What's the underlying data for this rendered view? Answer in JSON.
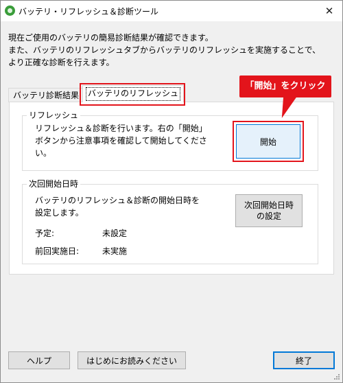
{
  "window": {
    "title": "バッテリ・リフレッシュ＆診断ツール",
    "close_glyph": "✕"
  },
  "intro": {
    "lines": [
      "現在ご使用のバッテリの簡易診断結果が確認できます。",
      "また、バッテリのリフレッシュタブからバッテリのリフレッシュを実施することで、",
      "より正確な診断を行えます。"
    ]
  },
  "tabs": [
    {
      "label": "バッテリ診断結果",
      "selected": false
    },
    {
      "label": "バッテリのリフレッシュ",
      "selected": true
    }
  ],
  "callout": {
    "text": "「開始」をクリック",
    "color": "#e3141b"
  },
  "refresh_group": {
    "title": "リフレッシュ",
    "lines": [
      "リフレッシュ＆診断を行います。右の「開始」",
      "ボタンから注意事項を確認して開始してくださ",
      "い。"
    ],
    "start_button": "開始"
  },
  "schedule_group": {
    "title": "次回開始日時",
    "lines": [
      "バッテリのリフレッシュ＆診断の開始日時を",
      "設定します。"
    ],
    "set_button_lines": [
      "次回開始日時",
      "の設定"
    ],
    "scheduled_label": "予定:",
    "scheduled_value": "未設定",
    "last_run_label": "前回実施日:",
    "last_run_value": "未実施"
  },
  "footer": {
    "help": "ヘルプ",
    "readme": "はじめにお読みください",
    "exit": "終了"
  },
  "colors": {
    "accent": "#0078d7",
    "highlight": "#e3141b"
  }
}
